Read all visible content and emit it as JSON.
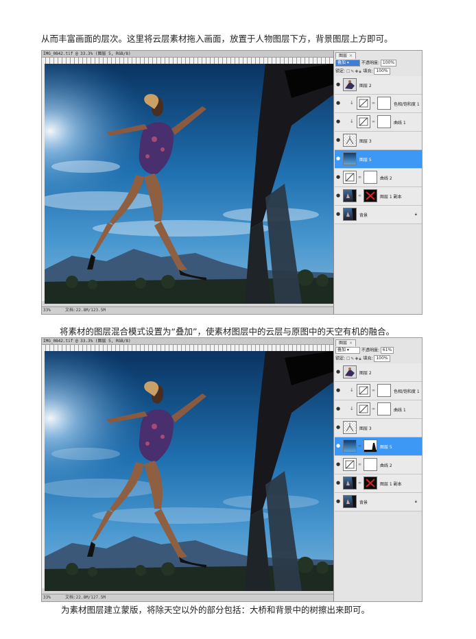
{
  "paragraphs": {
    "p1": "从而丰富画面的层次。这里将云层素材拖入画面，放置于人物图层下方，背景图层上方即可。",
    "p2": "将素材的图层混合模式设置为“叠加”，使素材图层中的云层与原图中的天空有机的融合。",
    "p3": "为素材图层建立蒙版，将除天空以外的部分包括：大桥和背景中的树擦出来即可。"
  },
  "screenshots": [
    {
      "doc_title": "IMG_0842.tif @ 33.3% (图层 5, RGB/8)",
      "zoom": "33%",
      "doc_size": "文档:22.8M/123.5M",
      "panel": {
        "tab": "图层",
        "blend_mode": "叠加",
        "opacity_label": "不透明度:",
        "opacity": "100%",
        "lock_label": "锁定:",
        "fill_label": "填充:",
        "fill": "100%"
      },
      "layers": [
        {
          "name": "图层 2",
          "thumb": "figure",
          "mask": false,
          "clip": false,
          "active": false
        },
        {
          "name": "色相/饱和度 1",
          "thumb": "adjust",
          "mask": true,
          "clip": true,
          "active": false
        },
        {
          "name": "曲线 1",
          "thumb": "curves",
          "mask": true,
          "clip": true,
          "active": false
        },
        {
          "name": "图层 3",
          "thumb": "sketch",
          "mask": false,
          "clip": false,
          "active": false
        },
        {
          "name": "图层 5",
          "thumb": "sky",
          "mask": false,
          "clip": false,
          "active": true
        },
        {
          "name": "曲线 2",
          "thumb": "curves",
          "mask": true,
          "clip": false,
          "active": false
        },
        {
          "name": "图层 1 副本",
          "thumb": "photo",
          "mask": "red",
          "clip": false,
          "active": false
        },
        {
          "name": "背景",
          "thumb": "photo",
          "mask": false,
          "clip": false,
          "active": false,
          "locked": true
        }
      ]
    },
    {
      "doc_title": "IMG_0842.tif @ 33.3% (图层 5, RGB/8)",
      "zoom": "33%",
      "doc_size": "文档:22.8M/127.5M",
      "panel": {
        "tab": "图层",
        "blend_mode": "叠加",
        "opacity_label": "不透明度:",
        "opacity": "61%",
        "lock_label": "锁定:",
        "fill_label": "填充:",
        "fill": "100%"
      },
      "layers": [
        {
          "name": "图层 2",
          "thumb": "figure",
          "mask": false,
          "clip": false,
          "active": false
        },
        {
          "name": "色相/饱和度 1",
          "thumb": "adjust",
          "mask": true,
          "clip": true,
          "active": false
        },
        {
          "name": "曲线 1",
          "thumb": "curves",
          "mask": true,
          "clip": true,
          "active": false
        },
        {
          "name": "图层 3",
          "thumb": "sketch",
          "mask": false,
          "clip": false,
          "active": false
        },
        {
          "name": "图层 5",
          "thumb": "sky",
          "mask": "skymask",
          "clip": false,
          "active": true
        },
        {
          "name": "曲线 2",
          "thumb": "curves",
          "mask": true,
          "clip": false,
          "active": false
        },
        {
          "name": "图层 1 副本",
          "thumb": "photo",
          "mask": "red",
          "clip": false,
          "active": false
        },
        {
          "name": "背景",
          "thumb": "photo",
          "mask": false,
          "clip": false,
          "active": false,
          "locked": true
        }
      ]
    }
  ],
  "colors": {
    "selection": "#3d97f5",
    "sky_top": "#0b3a66",
    "sky_mid": "#2a86c8",
    "bridge": "#1e1e22"
  },
  "icons": [
    "eye-icon",
    "chain-link-icon",
    "lock-icon",
    "clip-arrow-icon"
  ]
}
